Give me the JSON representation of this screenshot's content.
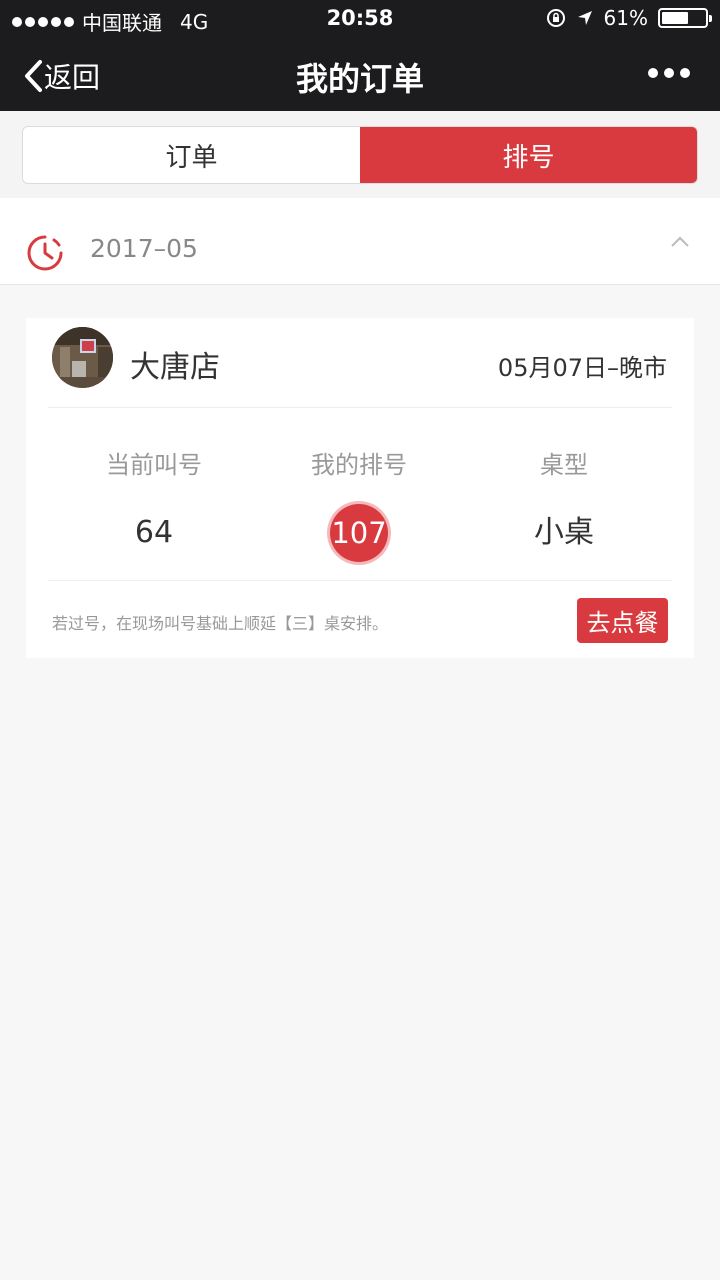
{
  "status_bar": {
    "carrier": "中国联通",
    "network": "4G",
    "time": "20:58",
    "battery": "61%",
    "battery_level": 0.61
  },
  "nav": {
    "back_label": "返回",
    "title": "我的订单"
  },
  "tabs": [
    {
      "label": "订单",
      "active": false
    },
    {
      "label": "排号",
      "active": true
    }
  ],
  "month": "2017–05",
  "queue_card": {
    "store_name": "大唐店",
    "date": "05月07日–晚市",
    "current_call_label": "当前叫号",
    "current_call_value": "64",
    "my_number_label": "我的排号",
    "my_number_value": "107",
    "table_type_label": "桌型",
    "table_type_value": "小桌",
    "note": "若过号，在现场叫号基础上顺延【三】桌安排。",
    "order_button": "去点餐"
  },
  "colors": {
    "accent": "#d93a3f",
    "nav_bg": "#1c1c1e"
  }
}
